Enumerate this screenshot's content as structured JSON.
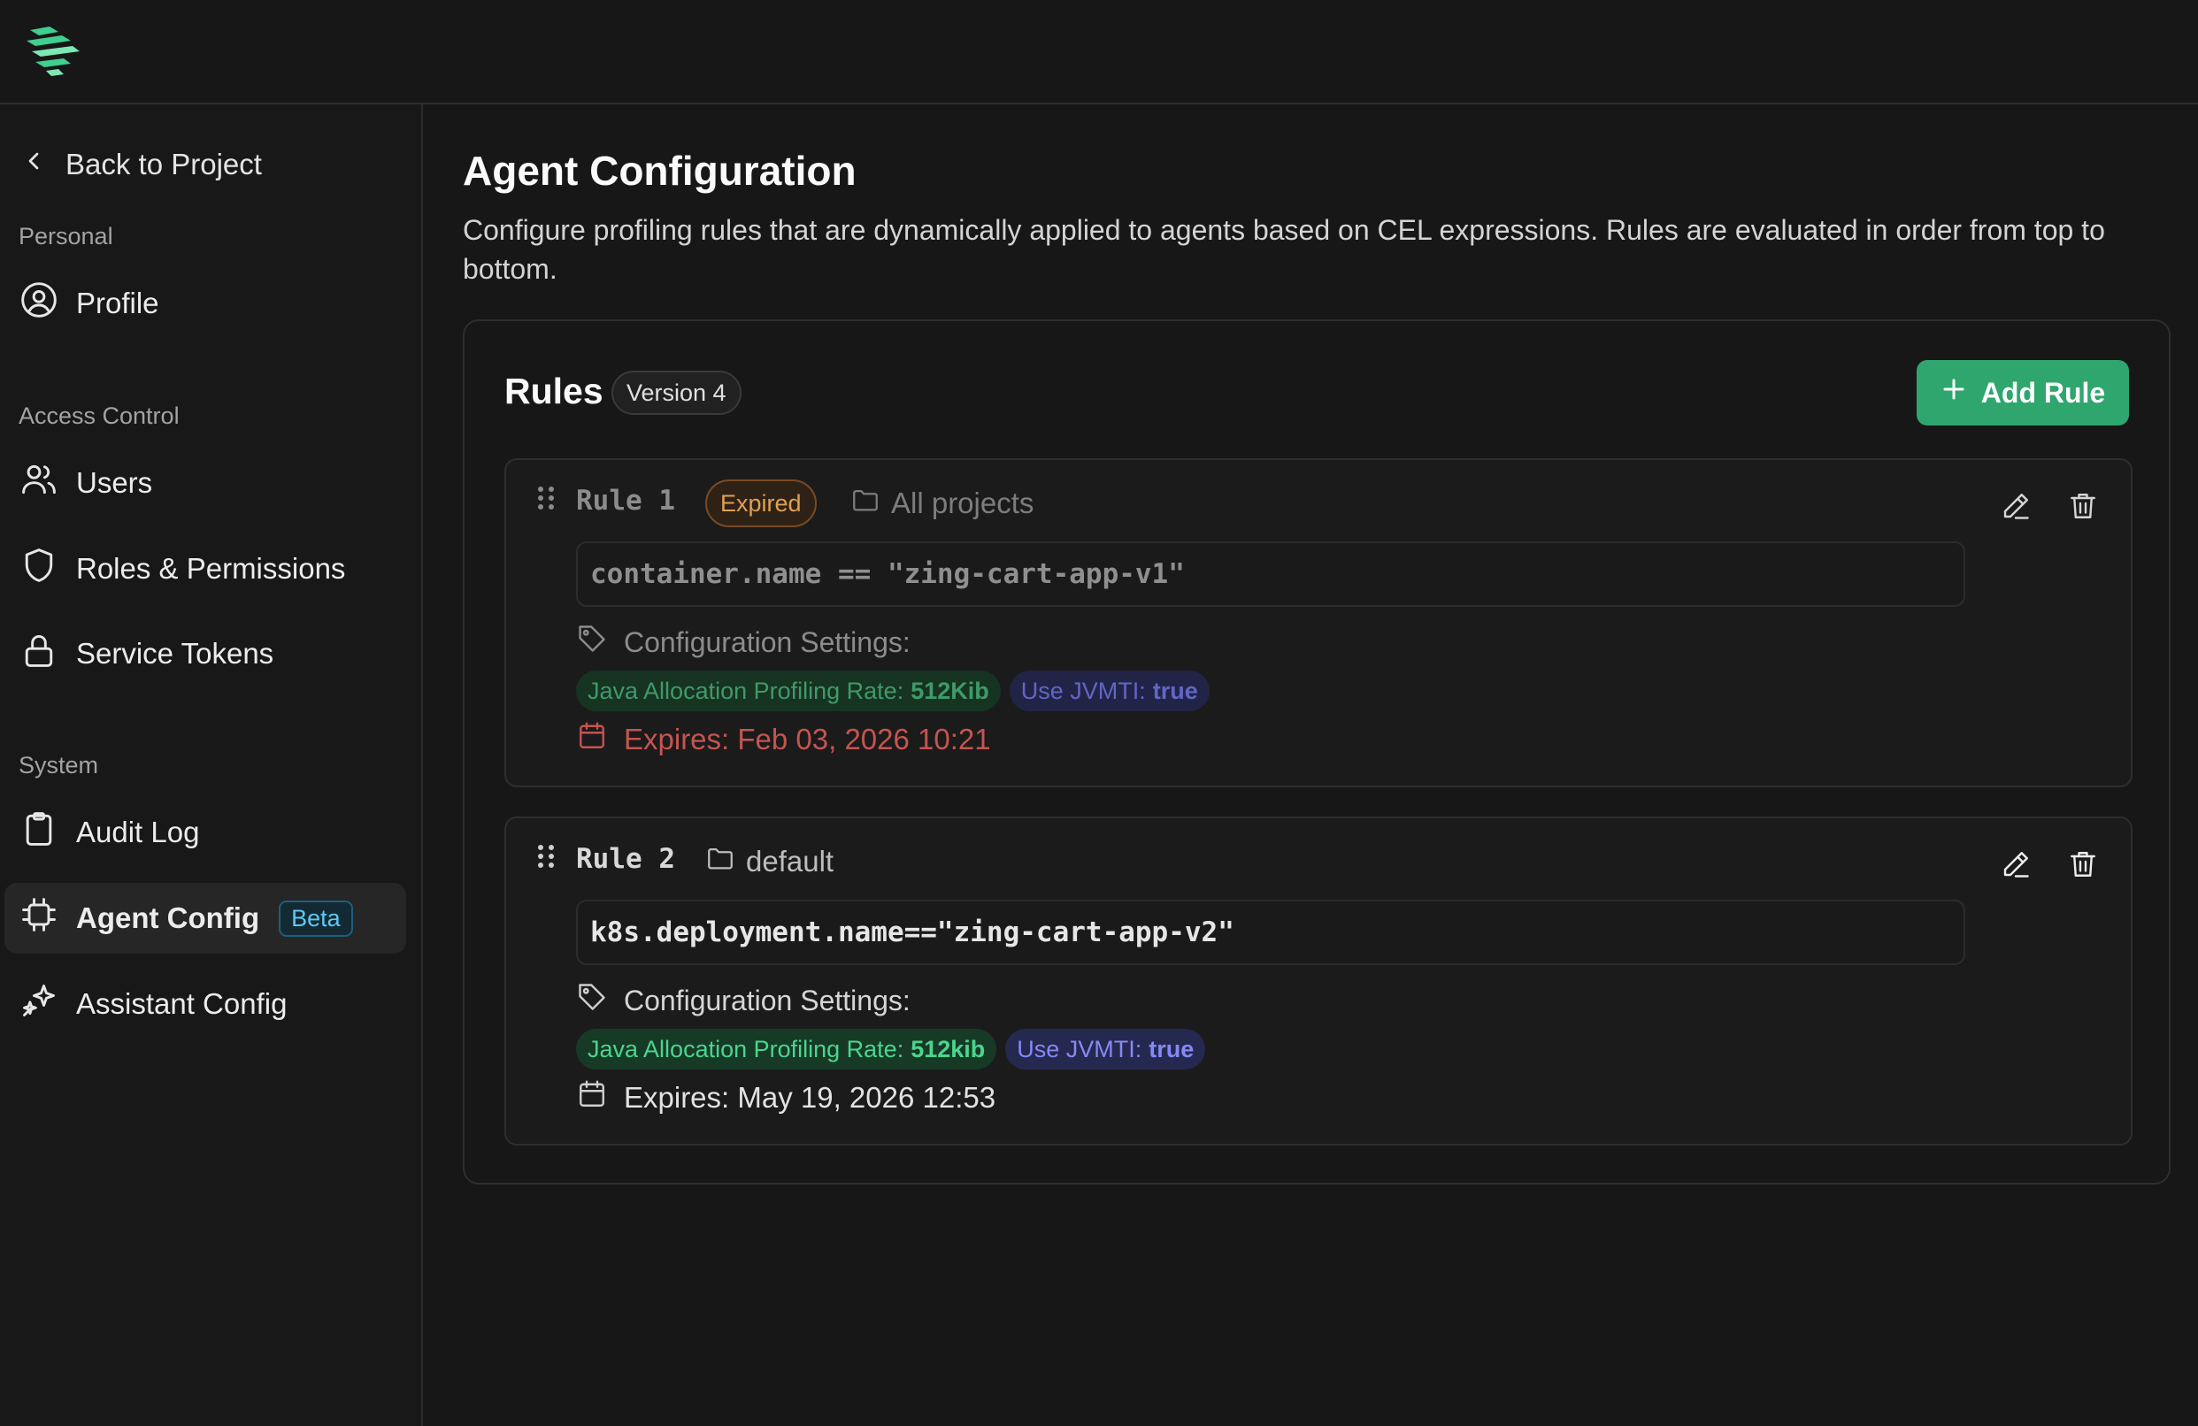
{
  "nav": {
    "back_label": "Back to Project",
    "sections": {
      "personal": "Personal",
      "access_control": "Access Control",
      "system": "System"
    },
    "items": {
      "profile": "Profile",
      "users": "Users",
      "roles": "Roles & Permissions",
      "tokens": "Service Tokens",
      "audit": "Audit Log",
      "agent_config": "Agent Config",
      "agent_config_badge": "Beta",
      "assistant_config": "Assistant Config"
    },
    "active_item": "Agent Config"
  },
  "page": {
    "title": "Agent Configuration",
    "description": "Configure profiling rules that are dynamically applied to agents based on CEL expressions. Rules are evaluated in order from top to bottom."
  },
  "rules_card": {
    "title": "Rules",
    "version": "Version 4",
    "add_button": "Add Rule"
  },
  "rules": [
    {
      "name": "Rule 1",
      "status": "Expired",
      "project": "All projects",
      "expression": "container.name == \"zing-cart-app-v1\"",
      "config_heading": "Configuration Settings:",
      "settings": [
        {
          "label": "Java Allocation Profiling Rate:",
          "value": "512Kib"
        },
        {
          "label": "Use JVMTI:",
          "value": "true"
        }
      ],
      "expires": "Expires: Feb 03, 2026 10:21"
    },
    {
      "name": "Rule 2",
      "status": "",
      "project": "default",
      "expression": "k8s.deployment.name==\"zing-cart-app-v2\"",
      "config_heading": "Configuration Settings:",
      "settings": [
        {
          "label": "Java Allocation Profiling Rate:",
          "value": "512kib"
        },
        {
          "label": "Use JVMTI:",
          "value": "true"
        }
      ],
      "expires": "Expires: May 19, 2026 12:53"
    }
  ],
  "colors": {
    "accent_green": "#2fa66e",
    "expired_orange": "#e0a052",
    "expired_red": "#c65450",
    "jvmti_blue": "#7f83f0",
    "beta_blue": "#5ec8f2"
  }
}
